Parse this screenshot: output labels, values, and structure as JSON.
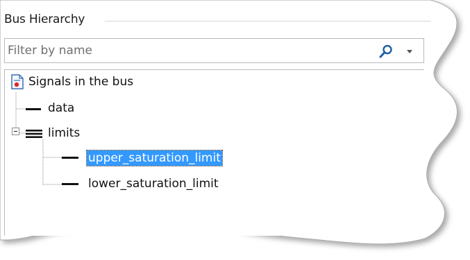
{
  "panel": {
    "title": "Bus Hierarchy"
  },
  "filter": {
    "placeholder": "Filter by name",
    "value": ""
  },
  "tree": {
    "root": {
      "label": "Signals in the bus",
      "icon": "bus-root-icon"
    },
    "nodes": [
      {
        "label": "data",
        "icon": "signal-icon",
        "expanded": null,
        "selected": false
      },
      {
        "label": "limits",
        "icon": "bus-icon",
        "expanded": true,
        "selected": false,
        "children": [
          {
            "label": "upper_saturation_limit",
            "icon": "signal-icon",
            "selected": true
          },
          {
            "label": "lower_saturation_limit",
            "icon": "signal-icon",
            "selected": false
          }
        ]
      }
    ]
  },
  "colors": {
    "selection": "#3399ff",
    "border": "#b9b9b9",
    "search_icon": "#1f5fa8"
  }
}
